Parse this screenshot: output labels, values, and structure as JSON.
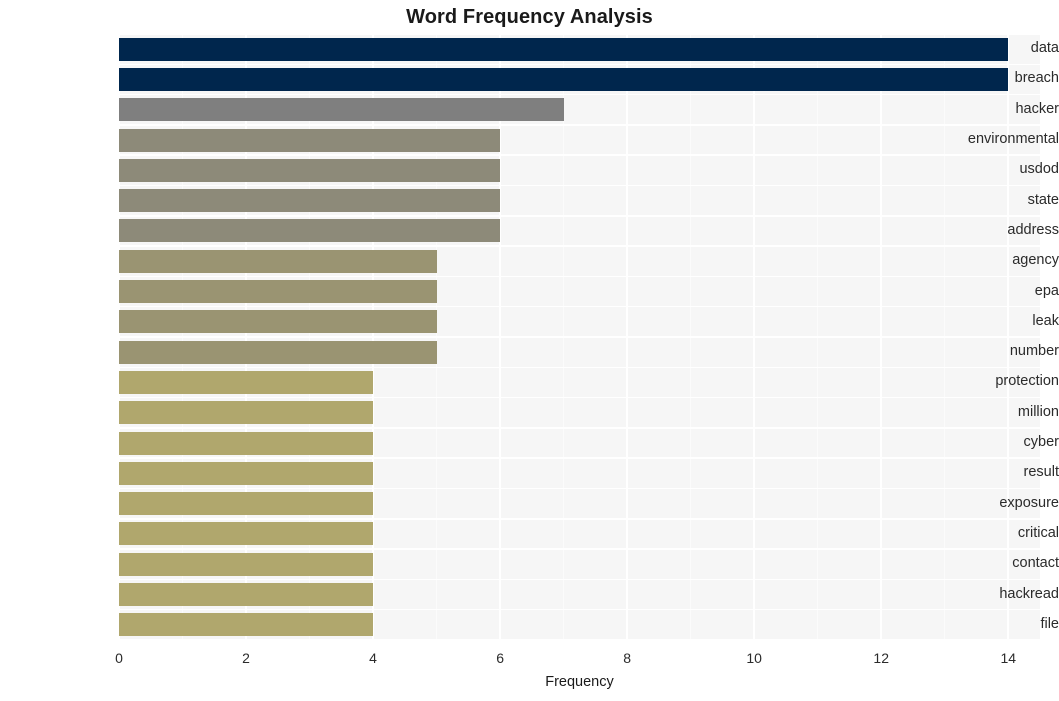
{
  "chart_data": {
    "type": "bar",
    "orientation": "horizontal",
    "title": "Word Frequency Analysis",
    "xlabel": "Frequency",
    "ylabel": "",
    "categories": [
      "data",
      "breach",
      "hacker",
      "environmental",
      "usdod",
      "state",
      "address",
      "agency",
      "epa",
      "leak",
      "number",
      "protection",
      "million",
      "cyber",
      "result",
      "exposure",
      "critical",
      "contact",
      "hackread",
      "file"
    ],
    "values": [
      14,
      14,
      7,
      6,
      6,
      6,
      6,
      5,
      5,
      5,
      5,
      4,
      4,
      4,
      4,
      4,
      4,
      4,
      4,
      4
    ],
    "bar_colors": [
      "#00264d",
      "#00264d",
      "#7f7f7f",
      "#8d8a79",
      "#8d8a79",
      "#8d8a79",
      "#8d8a79",
      "#9a9472",
      "#9a9472",
      "#9a9472",
      "#9a9472",
      "#b0a76d",
      "#b0a76d",
      "#b0a76d",
      "#b0a76d",
      "#b0a76d",
      "#b0a76d",
      "#b0a76d",
      "#b0a76d",
      "#b0a76d"
    ],
    "xlim": [
      0,
      14.5
    ],
    "xticks": [
      0,
      2,
      4,
      6,
      8,
      10,
      12,
      14
    ],
    "xtick_labels": [
      "0",
      "2",
      "4",
      "6",
      "8",
      "10",
      "12",
      "14"
    ],
    "grid": true,
    "grid_color": "#ffffff",
    "plot_background": "#f6f6f6",
    "figure_background": "#ffffff",
    "legend": null
  }
}
